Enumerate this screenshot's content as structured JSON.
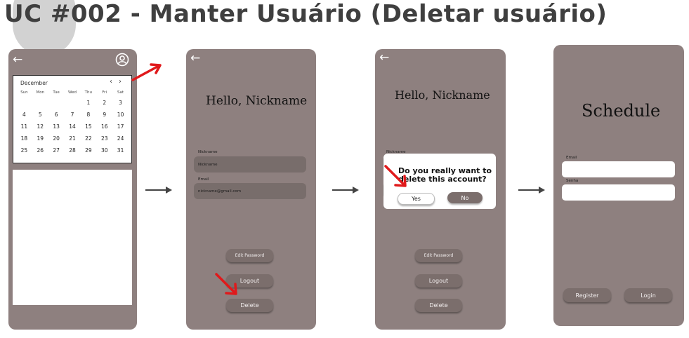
{
  "page": {
    "title": "UC #002 - Manter Usuário (Deletar usuário)"
  },
  "screen1": {
    "calendar": {
      "month": "December",
      "prev_icon": "chevron-left-icon",
      "next_icon": "chevron-right-icon",
      "weekdays": [
        "Sun",
        "Mon",
        "Tue",
        "Wed",
        "Thu",
        "Fri",
        "Sat"
      ],
      "weeks": [
        [
          "",
          "",
          "",
          "",
          "1",
          "2",
          "3"
        ],
        [
          "4",
          "5",
          "6",
          "7",
          "8",
          "9",
          "10"
        ],
        [
          "11",
          "12",
          "13",
          "14",
          "15",
          "16",
          "17"
        ],
        [
          "18",
          "19",
          "20",
          "21",
          "22",
          "23",
          "24"
        ],
        [
          "25",
          "26",
          "27",
          "28",
          "29",
          "30",
          "31"
        ]
      ]
    }
  },
  "screen2": {
    "greeting": "Hello, Nickname",
    "nickname_label": "Nickname",
    "nickname_value": "Nickname",
    "email_label": "Email",
    "email_value": "nickname@gmail.com",
    "edit_password": "Edit Password",
    "logout": "Logout",
    "delete": "Delete"
  },
  "screen3": {
    "greeting": "Hello, Nickname",
    "nickname_label": "Nickname",
    "dialog_line1": "Do you really want to",
    "dialog_line2": "delete this account?",
    "yes": "Yes",
    "no": "No",
    "edit_password": "Edit Password",
    "logout": "Logout",
    "delete": "Delete"
  },
  "screen4": {
    "title": "Schedule",
    "email_label": "Email",
    "senha_label": "Senha",
    "register": "Register",
    "login": "Login"
  },
  "colors": {
    "screen_bg": "#8e807f",
    "button_bg": "#7b6e6c",
    "field_bg": "#786d6b",
    "annotation_arrow": "#e0191b"
  }
}
